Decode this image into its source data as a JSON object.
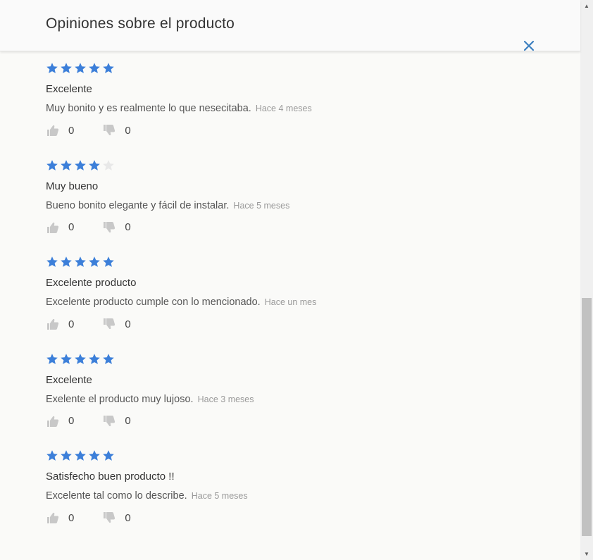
{
  "modal": {
    "title": "Opiniones sobre el producto",
    "close_icon": "close-icon"
  },
  "colors": {
    "star_filled": "#3c7fd9",
    "star_empty": "#e8e8e8",
    "thumb": "#c8c8c8",
    "close": "#3c7fbf"
  },
  "reviews": [
    {
      "rating": 5,
      "title": "Excelente",
      "text": "Muy bonito y es realmente lo que nesecitaba.",
      "date": "Hace 4 meses",
      "likes": "0",
      "dislikes": "0"
    },
    {
      "rating": 4,
      "title": "Muy bueno",
      "text": "Bueno bonito elegante y fácil de instalar.",
      "date": "Hace 5 meses",
      "likes": "0",
      "dislikes": "0"
    },
    {
      "rating": 5,
      "title": "Excelente producto",
      "text": "Excelente producto cumple con lo mencionado.",
      "date": "Hace un mes",
      "likes": "0",
      "dislikes": "0"
    },
    {
      "rating": 5,
      "title": "Excelente",
      "text": "Exelente el producto muy lujoso.",
      "date": "Hace 3 meses",
      "likes": "0",
      "dislikes": "0"
    },
    {
      "rating": 5,
      "title": "Satisfecho buen producto !!",
      "text": "Excelente tal como lo describe.",
      "date": "Hace 5 meses",
      "likes": "0",
      "dislikes": "0"
    }
  ]
}
